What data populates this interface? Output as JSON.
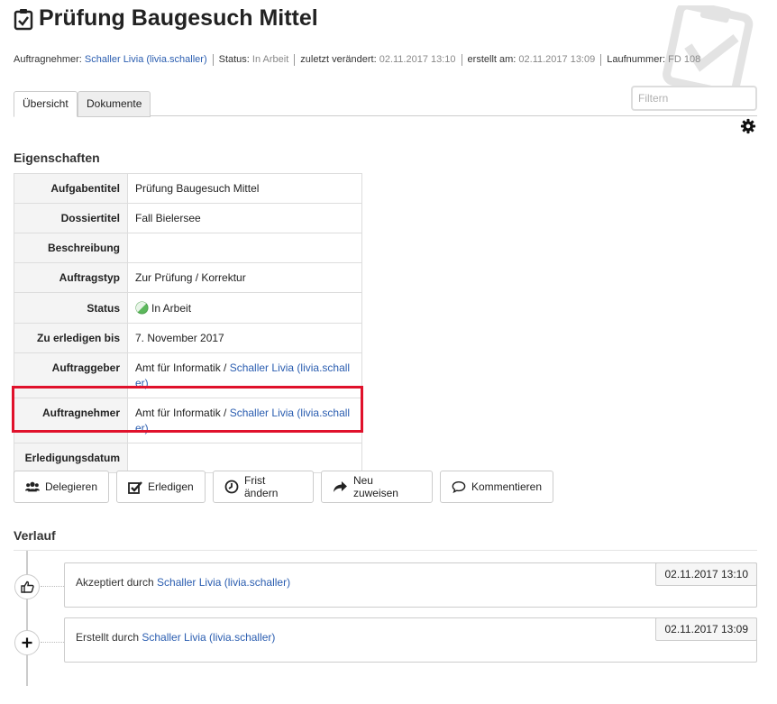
{
  "header": {
    "title": "Prüfung Baugesuch Mittel",
    "icon": "clipboard-check-icon"
  },
  "meta": {
    "assignee_label": "Auftragnehmer:",
    "assignee_value": "Schaller Livia (livia.schaller)",
    "status_label": "Status:",
    "status_value": "In Arbeit",
    "modified_label": "zuletzt verändert:",
    "modified_value": "02.11.2017 13:10",
    "created_label": "erstellt am:",
    "created_value": "02.11.2017 13:09",
    "number_label": "Laufnummer:",
    "number_value": "FD 108"
  },
  "tabs": [
    {
      "label": "Übersicht",
      "active": true
    },
    {
      "label": "Dokumente",
      "active": false
    }
  ],
  "filter": {
    "placeholder": "Filtern"
  },
  "properties": {
    "heading": "Eigenschaften",
    "rows": {
      "title": {
        "label": "Aufgabentitel",
        "value": "Prüfung Baugesuch Mittel"
      },
      "dossier": {
        "label": "Dossiertitel",
        "value": "Fall Bielersee"
      },
      "description": {
        "label": "Beschreibung",
        "value": ""
      },
      "type": {
        "label": "Auftragstyp",
        "value": "Zur Prüfung / Korrektur"
      },
      "status": {
        "label": "Status",
        "value": "In Arbeit"
      },
      "deadline": {
        "label": "Zu erledigen bis",
        "value": "7. November 2017"
      },
      "issuer": {
        "label": "Auftraggeber",
        "org": "Amt für Informatik / ",
        "person_line1": "Schaller Livia (livia.schall",
        "person_line2": "er)"
      },
      "assignee": {
        "label": "Auftragnehmer",
        "org": "Amt für Informatik / ",
        "person_line1": "Schaller Livia (livia.schall",
        "person_line2": "er)"
      },
      "completed": {
        "label": "Erledigungsdatum",
        "value": ""
      }
    }
  },
  "actions": {
    "delegate": "Delegieren",
    "complete": "Erledigen",
    "deadline": "Frist ändern",
    "reassign": "Neu zuweisen",
    "comment": "Kommentieren"
  },
  "history": {
    "heading": "Verlauf",
    "events": [
      {
        "prefix": "Akzeptiert durch ",
        "user": "Schaller Livia (livia.schaller)",
        "date": "02.11.2017 13:10",
        "icon": "thumbs-up-icon"
      },
      {
        "prefix": "Erstellt durch ",
        "user": "Schaller Livia (livia.schaller)",
        "date": "02.11.2017 13:09",
        "icon": "plus-icon"
      }
    ]
  },
  "colors": {
    "link": "#2a5db0",
    "highlight": "#e0112b",
    "status_green": "#5cb85c"
  }
}
